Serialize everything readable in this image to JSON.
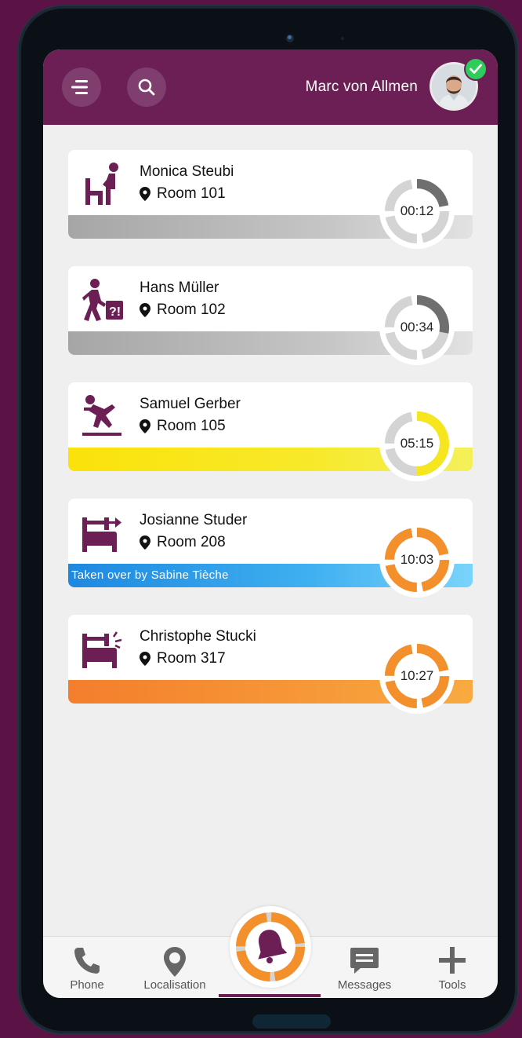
{
  "header": {
    "user_name": "Marc von Allmen",
    "user_status": "online"
  },
  "colors": {
    "brand": "#6b1f55",
    "gray": "#a9a9a9",
    "yellow": "#f6e61e",
    "blue": "#35a3e6",
    "orange": "#f3902c",
    "online": "#2ecc5a"
  },
  "alerts": [
    {
      "icon": "person-getting-up-icon",
      "name": "Monica Steubi",
      "room": "Room 101",
      "timer": "00:12",
      "level": "gray",
      "progress": 0.22
    },
    {
      "icon": "person-wandering-icon",
      "name": "Hans Müller",
      "room": "Room 102",
      "timer": "00:34",
      "level": "gray",
      "progress": 0.28
    },
    {
      "icon": "person-falling-icon",
      "name": "Samuel Gerber",
      "room": "Room 105",
      "timer": "05:15",
      "level": "yellow",
      "progress": 0.5
    },
    {
      "icon": "bed-exit-icon",
      "name": "Josianne Studer",
      "room": "Room 208",
      "timer": "10:03",
      "level": "orange",
      "progress": 1.0,
      "bar_text": "Taken over by Sabine Tièche",
      "bar": "blue"
    },
    {
      "icon": "bed-alarm-icon",
      "name": "Christophe Stucki",
      "room": "Room 317",
      "timer": "10:27",
      "level": "orange",
      "progress": 1.0
    }
  ],
  "nav": {
    "phone": "Phone",
    "localisation": "Localisation",
    "messages": "Messages",
    "tools": "Tools",
    "center_icon": "bell-icon"
  }
}
